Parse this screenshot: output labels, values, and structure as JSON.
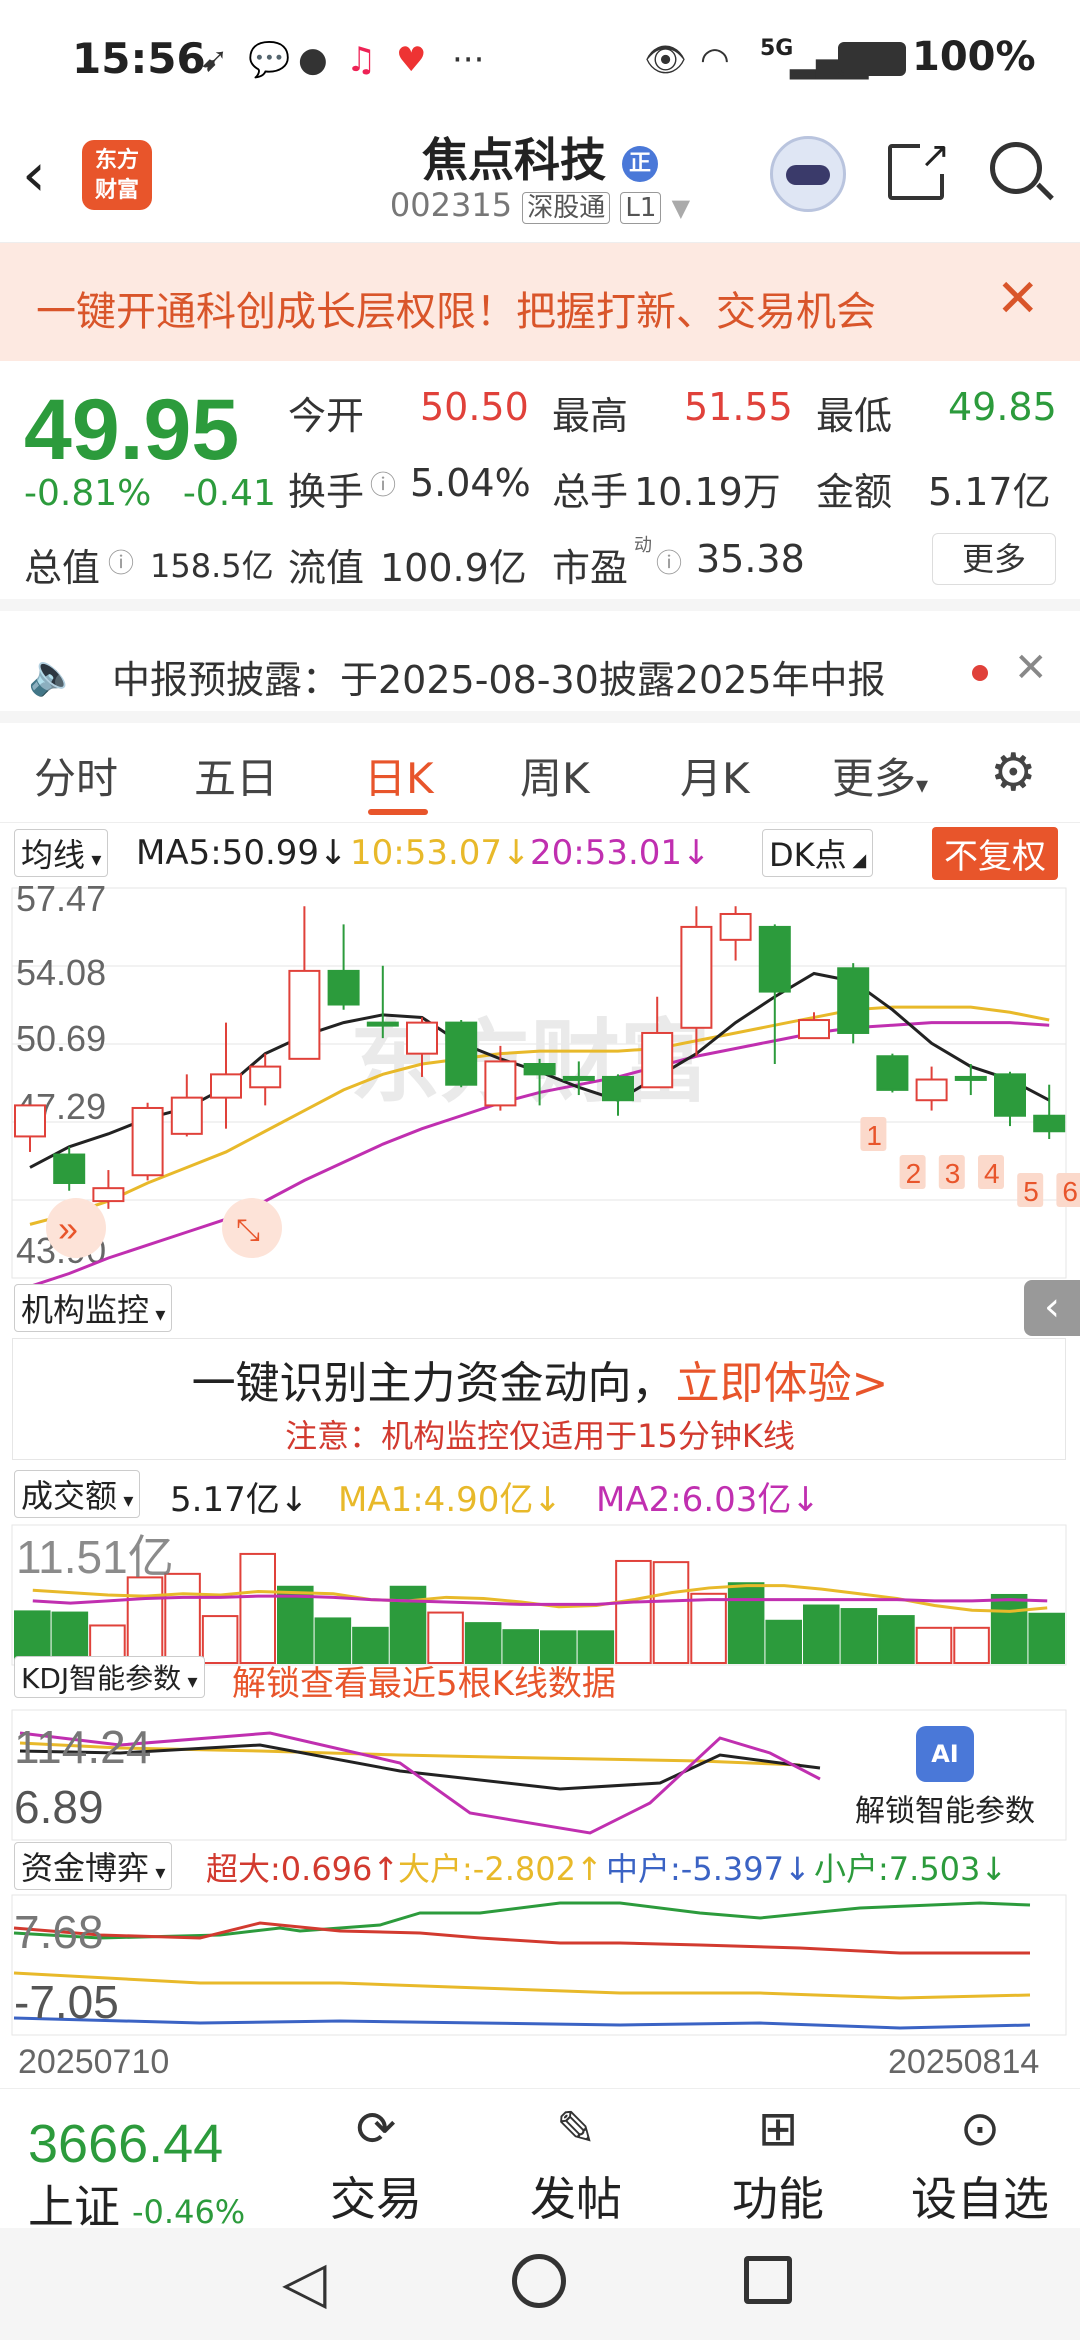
{
  "status": {
    "time": "15:56",
    "net": "5G",
    "battery": "100%"
  },
  "header": {
    "logo_line1": "东方",
    "logo_line2": "财富",
    "stock_name": "焦点科技",
    "stock_code": "002315",
    "tag1": "深股通",
    "tag2": "L1"
  },
  "banner": {
    "text": "一键开通科创成长层权限！把握打新、交易机会"
  },
  "quote": {
    "price": "49.95",
    "change_pct": "-0.81%",
    "change_abs": "-0.41",
    "open_label": "今开",
    "open": "50.50",
    "high_label": "最高",
    "high": "51.55",
    "low_label": "最低",
    "low": "49.85",
    "turnover_label": "换手",
    "turnover": "5.04%",
    "volume_label": "总手",
    "volume": "10.19万",
    "amount_label": "金额",
    "amount": "5.17亿",
    "mktcap_label": "总值",
    "mktcap": "158.5亿",
    "float_label": "流值",
    "float": "100.9亿",
    "pe_label": "市盈",
    "pe_sup": "动",
    "pe": "35.38",
    "more": "更多"
  },
  "notice": {
    "text": "中报预披露：于2025-08-30披露2025年中报"
  },
  "tabs": [
    "分时",
    "五日",
    "日K",
    "周K",
    "月K",
    "更多"
  ],
  "active_tab": 2,
  "kline_bar": {
    "ma_select": "均线",
    "ma5": "MA5:50.99↓",
    "ma10": "10:53.07↓",
    "ma20": "20:53.01↓",
    "dk": "DK点",
    "fq": "不复权"
  },
  "colors": {
    "up": "#e0413a",
    "down": "#2c9b3c",
    "accent": "#e8552b",
    "ma5": "#222222",
    "ma10": "#e8b92a",
    "ma20": "#c02fb0"
  },
  "chart_data": [
    {
      "type": "candlestick",
      "ylim": [
        43.9,
        57.47
      ],
      "y_ticks": [
        "57.47",
        "54.08",
        "50.69",
        "47.29",
        "43.90"
      ],
      "candles": [
        {
          "o": 48.6,
          "c": 49.8,
          "h": 49.8,
          "l": 48.0
        },
        {
          "o": 47.9,
          "c": 46.8,
          "h": 48.2,
          "l": 46.5
        },
        {
          "o": 46.1,
          "c": 46.6,
          "h": 47.3,
          "l": 45.8
        },
        {
          "o": 47.1,
          "c": 49.7,
          "h": 49.9,
          "l": 46.9
        },
        {
          "o": 48.7,
          "c": 50.1,
          "h": 51.0,
          "l": 48.6
        },
        {
          "o": 50.1,
          "c": 51.0,
          "h": 53.0,
          "l": 48.9
        },
        {
          "o": 50.5,
          "c": 51.3,
          "h": 51.8,
          "l": 49.8
        },
        {
          "o": 51.6,
          "c": 55.0,
          "h": 57.5,
          "l": 51.6
        },
        {
          "o": 55.0,
          "c": 53.7,
          "h": 56.8,
          "l": 53.5
        },
        {
          "o": 53.0,
          "c": 52.9,
          "h": 55.2,
          "l": 52.4
        },
        {
          "o": 51.8,
          "c": 53.0,
          "h": 53.2,
          "l": 50.9
        },
        {
          "o": 53.0,
          "c": 50.6,
          "h": 53.1,
          "l": 50.5
        },
        {
          "o": 49.8,
          "c": 51.5,
          "h": 52.1,
          "l": 49.6
        },
        {
          "o": 51.4,
          "c": 51.0,
          "h": 51.6,
          "l": 49.8
        },
        {
          "o": 50.9,
          "c": 50.9,
          "h": 51.5,
          "l": 50.2
        },
        {
          "o": 50.9,
          "c": 50.0,
          "h": 51.0,
          "l": 49.4
        },
        {
          "o": 50.5,
          "c": 52.6,
          "h": 54.0,
          "l": 50.5
        },
        {
          "o": 52.8,
          "c": 56.7,
          "h": 57.5,
          "l": 51.7
        },
        {
          "o": 56.2,
          "c": 57.2,
          "h": 57.5,
          "l": 55.4
        },
        {
          "o": 56.7,
          "c": 54.2,
          "h": 56.8,
          "l": 51.4
        },
        {
          "o": 52.4,
          "c": 53.1,
          "h": 53.4,
          "l": 52.4
        },
        {
          "o": 55.1,
          "c": 52.6,
          "h": 55.3,
          "l": 52.2
        },
        {
          "o": 51.7,
          "c": 50.4,
          "h": 51.8,
          "l": 50.3
        },
        {
          "o": 50.0,
          "c": 50.8,
          "h": 51.3,
          "l": 49.6
        },
        {
          "o": 50.9,
          "c": 50.9,
          "h": 51.4,
          "l": 50.2
        },
        {
          "o": 51.0,
          "c": 49.4,
          "h": 51.1,
          "l": 49.0
        },
        {
          "o": 49.4,
          "c": 48.8,
          "h": 50.6,
          "l": 48.5
        }
      ],
      "ma5": [
        47.4,
        48.2,
        48.7,
        49.3,
        49.7,
        50.5,
        51.8,
        52.5,
        53.0,
        53.3,
        53.2,
        52.2,
        51.6,
        51.1,
        50.5,
        50.0,
        50.9,
        51.8,
        53.0,
        54.0,
        54.9,
        54.6,
        53.5,
        52.2,
        51.3,
        50.8,
        50.0
      ],
      "ma10": [
        45.2,
        45.6,
        46.1,
        46.8,
        47.4,
        48.0,
        48.8,
        49.6,
        50.4,
        51.0,
        51.4,
        51.6,
        51.8,
        51.9,
        51.9,
        51.9,
        52.0,
        52.3,
        52.6,
        52.9,
        53.2,
        53.5,
        53.6,
        53.6,
        53.6,
        53.4,
        53.1
      ],
      "ma20": [
        42.8,
        43.3,
        43.9,
        44.4,
        44.9,
        45.4,
        46.1,
        46.9,
        47.6,
        48.3,
        48.9,
        49.4,
        49.9,
        50.3,
        50.6,
        50.9,
        51.3,
        51.7,
        52.0,
        52.3,
        52.6,
        52.8,
        52.9,
        53.0,
        53.0,
        53.0,
        52.9
      ],
      "markers": [
        "1",
        "2",
        "3",
        "4",
        "5",
        "6"
      ],
      "watermark": "东方财富"
    },
    {
      "type": "bar",
      "title": "成交额",
      "y_tick": "11.51亿",
      "value_label": "5.17亿↓",
      "ma1": "MA1:4.90亿↓",
      "ma2": "MA2:6.03亿↓",
      "values": [
        4.4,
        4.3,
        3.2,
        7.3,
        7.6,
        4.0,
        9.3,
        6.5,
        3.8,
        3.0,
        6.5,
        4.3,
        3.4,
        2.8,
        2.7,
        2.7,
        8.7,
        8.6,
        5.9,
        6.8,
        3.6,
        4.9,
        4.6,
        4.0,
        3.0,
        3.0,
        5.8,
        4.2
      ],
      "up": [
        false,
        false,
        true,
        true,
        true,
        true,
        true,
        false,
        false,
        false,
        false,
        true,
        false,
        false,
        false,
        false,
        true,
        true,
        true,
        false,
        false,
        false,
        false,
        false,
        true,
        true,
        false,
        false
      ],
      "ma1_line": [
        6.2,
        6.0,
        5.8,
        5.7,
        5.9,
        5.8,
        6.1,
        6.0,
        5.9,
        5.4,
        5.3,
        5.6,
        5.5,
        5.2,
        4.8,
        4.9,
        5.4,
        6.0,
        6.4,
        6.6,
        6.6,
        6.3,
        5.9,
        5.5,
        4.9,
        4.5,
        4.4,
        4.7
      ],
      "ma2_line": [
        5.3,
        5.1,
        5.3,
        5.5,
        5.6,
        5.6,
        5.7,
        5.7,
        5.6,
        5.4,
        5.3,
        5.2,
        5.1,
        5.0,
        5.0,
        5.0,
        5.2,
        5.3,
        5.4,
        5.4,
        5.4,
        5.4,
        5.4,
        5.4,
        5.3,
        5.3,
        5.4,
        5.3
      ]
    }
  ],
  "jgjk": {
    "select": "机构监控",
    "headline": "一键识别主力资金动向，",
    "cta": "立即体验>",
    "note": "注意：机构监控仅适用于15分钟K线"
  },
  "kdj": {
    "select": "KDJ智能参数",
    "unlock_text": "解锁查看最近5根K线数据",
    "ticks": [
      "114.24",
      "6.89"
    ],
    "ai_label": "AI",
    "ai_caption": "解锁智能参数"
  },
  "zjby": {
    "select": "资金博弈",
    "super": "超大:0.696↑",
    "big": "大户:-2.802↑",
    "mid": "中户:-5.397↓",
    "small": "小户:7.503↓",
    "ticks": [
      "7.68",
      "-7.05"
    ]
  },
  "dates": {
    "start": "20250710",
    "end": "20250814"
  },
  "bottom": {
    "index_value": "3666.44",
    "index_name": "上证",
    "index_chg": "-0.46%",
    "trade": "交易",
    "post": "发帖",
    "func": "功能",
    "watch": "设自选"
  }
}
